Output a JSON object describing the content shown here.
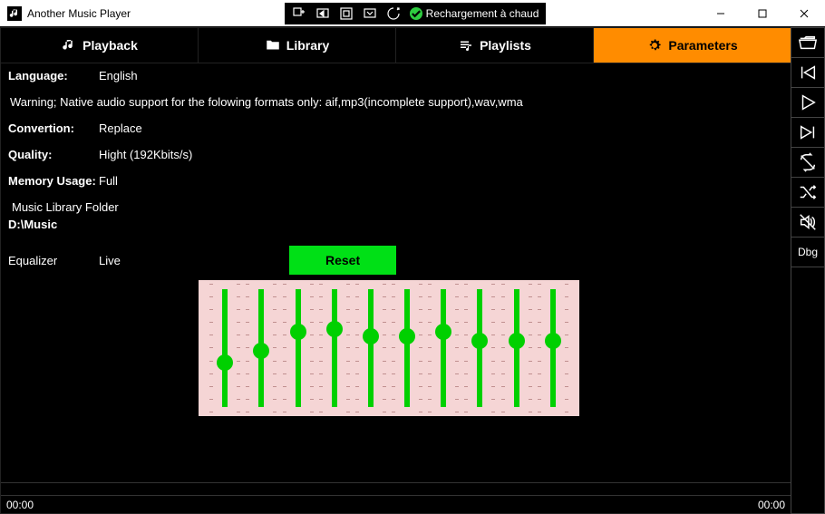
{
  "app": {
    "title": "Another Music Player",
    "devbar": {
      "hot_reload": "Rechargement à chaud"
    }
  },
  "tabs": [
    {
      "label": "Playback"
    },
    {
      "label": "Library"
    },
    {
      "label": "Playlists"
    },
    {
      "label": "Parameters"
    }
  ],
  "params": {
    "language": {
      "label": "Language:",
      "value": "English"
    },
    "warning": "Warning; Native audio support for the folowing formats only: aif,mp3(incomplete support),wav,wma",
    "conversion": {
      "label": "Convertion:",
      "value": "Replace"
    },
    "quality": {
      "label": "Quality:",
      "value": "Hight (192Kbits/s)"
    },
    "memory": {
      "label": "Memory Usage:",
      "value": "Full"
    },
    "folder": {
      "label": "Music Library Folder",
      "value": "D:\\Music"
    },
    "equalizer": {
      "label": "Equalizer",
      "value": "Live",
      "reset": "Reset"
    }
  },
  "eq_bands": [
    {
      "pos": 62
    },
    {
      "pos": 52
    },
    {
      "pos": 36
    },
    {
      "pos": 34
    },
    {
      "pos": 40
    },
    {
      "pos": 40
    },
    {
      "pos": 36
    },
    {
      "pos": 44
    },
    {
      "pos": 44
    },
    {
      "pos": 44
    }
  ],
  "status": {
    "left": "00:00",
    "right": "00:00"
  },
  "sidebar": {
    "dbg": "Dbg"
  }
}
